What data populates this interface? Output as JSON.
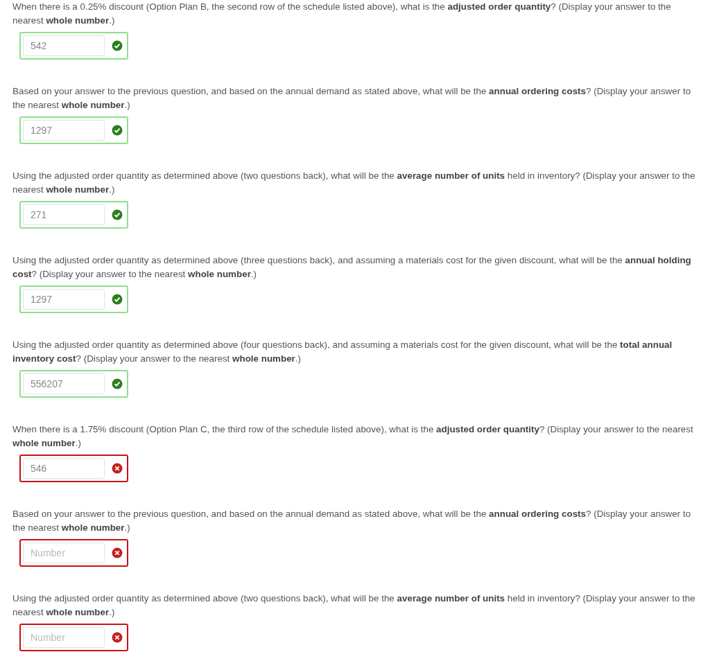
{
  "parts": [
    {
      "questions": [
        {
          "text": "When there is a 0.25% discount (Option Plan B, the second row of the schedule listed above), what is the **adjusted order quantity**? (Display your answer to the nearest **whole number**.)",
          "value": "542",
          "correct": true
        },
        {
          "text": "Based on your answer to the previous question, and based on the annual demand as stated above, what will be the **annual ordering costs**? (Display your answer to the nearest **whole number**.)",
          "value": "1297",
          "correct": true
        },
        {
          "text": "Using the adjusted order quantity as determined above (two questions back), what will be the **average number of units** held in inventory? (Display your answer to the nearest **whole number**.)",
          "value": "271",
          "correct": true
        },
        {
          "text": "Using the adjusted order quantity as determined above (three questions back), and assuming a materials cost for the given discount, what will be the **annual holding cost**? (Display your answer to the nearest **whole number**.)",
          "value": "1297",
          "correct": true
        },
        {
          "text": "Using the adjusted order quantity as determined above (four questions back), and assuming a materials cost for the given discount, what will be the **total annual inventory cost**? (Display your answer to the nearest **whole number**.)",
          "value": "556207",
          "correct": true
        }
      ]
    },
    {
      "questions": [
        {
          "text": "When there is a 1.75% discount (Option Plan C, the third row of the schedule listed above), what is the **adjusted order quantity**? (Display your answer to the nearest **whole number**.)",
          "value": "546",
          "correct": false
        },
        {
          "text": "Based on your answer to the previous question, and based on the annual demand as stated above, what will be the **annual ordering costs**? (Display your answer to the nearest **whole number**.)",
          "placeholder": "Number",
          "correct": false
        },
        {
          "text": "Using the adjusted order quantity as determined above (two questions back), what will be the **average number of units** held in inventory? (Display your answer to the nearest **whole number**.)",
          "placeholder": "Number",
          "correct": false
        }
      ]
    }
  ]
}
